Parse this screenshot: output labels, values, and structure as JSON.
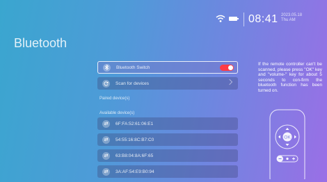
{
  "status": {
    "time": "08:41",
    "date_line1": "2023.05.18",
    "date_line2": "Thu   AM"
  },
  "page": {
    "title": "Bluetooth"
  },
  "bluetooth_switch": {
    "label": "Bluetooth Switch",
    "enabled": true
  },
  "scan": {
    "label": "Scan for devices"
  },
  "paired_heading": "Paired device(s)",
  "available_heading": "Available device(s)",
  "devices": [
    {
      "mac": "6F:FA:52:61:06:E1"
    },
    {
      "mac": "54:55:16:8C:B7:C0"
    },
    {
      "mac": "63:B8:04:8A:6F:65"
    },
    {
      "mac": "3A:AF:54:E9:B0:94"
    }
  ],
  "help_text": "If the remote controller can't be scanned, please press \"OK\" key and \"volume-\" key for about 5 seconds to con-firm the bluetooth function has been turned on.",
  "remote": {
    "ok_label": "OK"
  },
  "colors": {
    "toggle_on": "#ff3b46"
  },
  "icons": [
    "wifi-icon",
    "battery-icon",
    "bluetooth-icon",
    "refresh-icon",
    "device-icon",
    "remote-control-icon"
  ]
}
